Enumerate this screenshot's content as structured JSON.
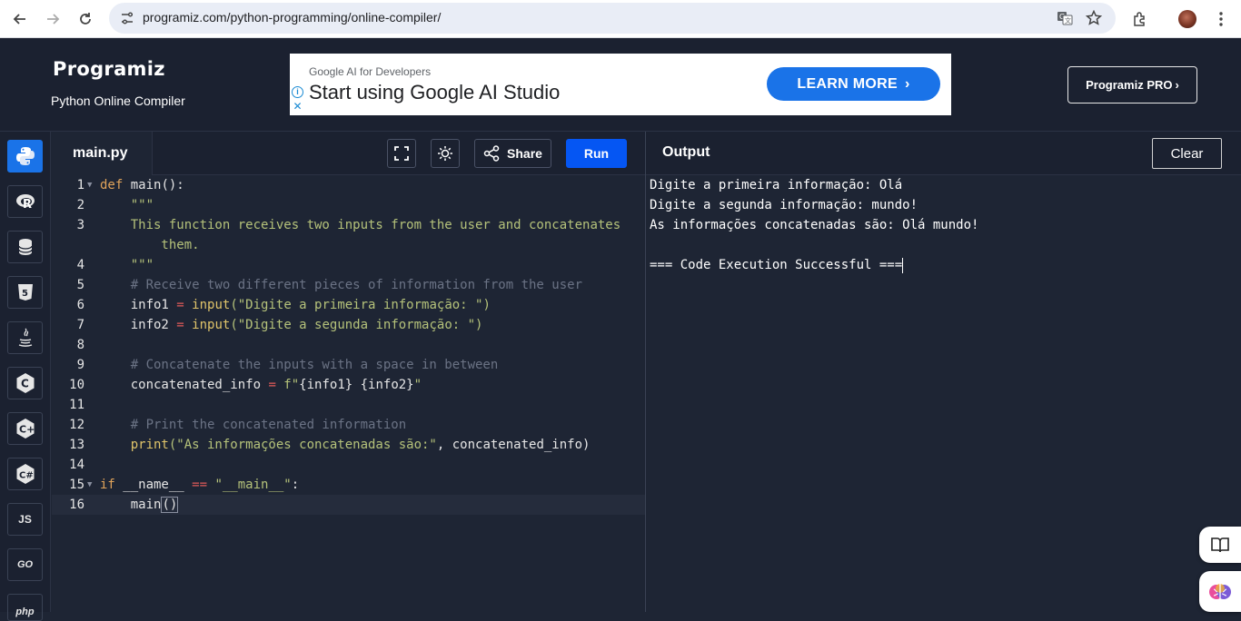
{
  "browser": {
    "url": "programiz.com/python-programming/online-compiler/"
  },
  "header": {
    "logo": "Programiz",
    "subtitle": "Python Online Compiler",
    "ad": {
      "small": "Google AI for Developers",
      "big": "Start using Google AI Studio",
      "cta": "LEARN MORE"
    },
    "pro_button": "Programiz PRO"
  },
  "languages": [
    {
      "name": "python-icon",
      "label": "",
      "active": true
    },
    {
      "name": "r-icon",
      "label": "R"
    },
    {
      "name": "sql-icon",
      "label": ""
    },
    {
      "name": "html-icon",
      "label": "5"
    },
    {
      "name": "java-icon",
      "label": ""
    },
    {
      "name": "c-icon",
      "label": "C"
    },
    {
      "name": "cpp-icon",
      "label": "C+"
    },
    {
      "name": "csharp-icon",
      "label": "C#"
    },
    {
      "name": "js-icon",
      "label": "JS"
    },
    {
      "name": "go-icon",
      "label": "GO"
    },
    {
      "name": "php-icon",
      "label": "php"
    }
  ],
  "editor": {
    "filename": "main.py",
    "share_label": "Share",
    "run_label": "Run",
    "lines": [
      {
        "n": "1",
        "fold": true
      },
      {
        "n": "2"
      },
      {
        "n": "3"
      },
      {
        "n": ""
      },
      {
        "n": "4"
      },
      {
        "n": "5"
      },
      {
        "n": "6"
      },
      {
        "n": "7"
      },
      {
        "n": "8"
      },
      {
        "n": "9"
      },
      {
        "n": "10"
      },
      {
        "n": "11"
      },
      {
        "n": "12"
      },
      {
        "n": "13"
      },
      {
        "n": "14"
      },
      {
        "n": "15",
        "fold": true
      },
      {
        "n": "16"
      }
    ],
    "code": {
      "l1_kw": "def",
      "l1_rest": " main():",
      "l2": "    \"\"\"",
      "l3": "    This function receives two inputs from the user and concatenates",
      "l3b": "        them.",
      "l4": "    \"\"\"",
      "l5": "    # Receive two different pieces of information from the user",
      "l6_a": "    info1 ",
      "l6_op": "=",
      "l6_fn": " input",
      "l6_str": "(\"Digite a primeira informação: \")",
      "l7_a": "    info2 ",
      "l7_op": "=",
      "l7_fn": " input",
      "l7_str": "(\"Digite a segunda informação: \")",
      "l9": "    # Concatenate the inputs with a space in between",
      "l10_a": "    concatenated_info ",
      "l10_op": "=",
      "l10_str1": " f\"",
      "l10_b": "{info1} {info2}",
      "l10_str2": "\"",
      "l12": "    # Print the concatenated information",
      "l13_fn": "    print",
      "l13_str": "(\"As informações concatenadas são:\"",
      "l13_rest": ", concatenated_info)",
      "l15_kw": "if",
      "l15_a": " __name__ ",
      "l15_op": "==",
      "l15_str": " \"__main__\"",
      "l15_rest": ":",
      "l16_a": "    main",
      "l16_b": "()"
    }
  },
  "output": {
    "title": "Output",
    "clear_label": "Clear",
    "lines": [
      "Digite a primeira informação: Olá",
      "Digite a segunda informação: mundo!",
      "As informações concatenadas são: Olá mundo!",
      "",
      "=== Code Execution Successful ==="
    ]
  }
}
